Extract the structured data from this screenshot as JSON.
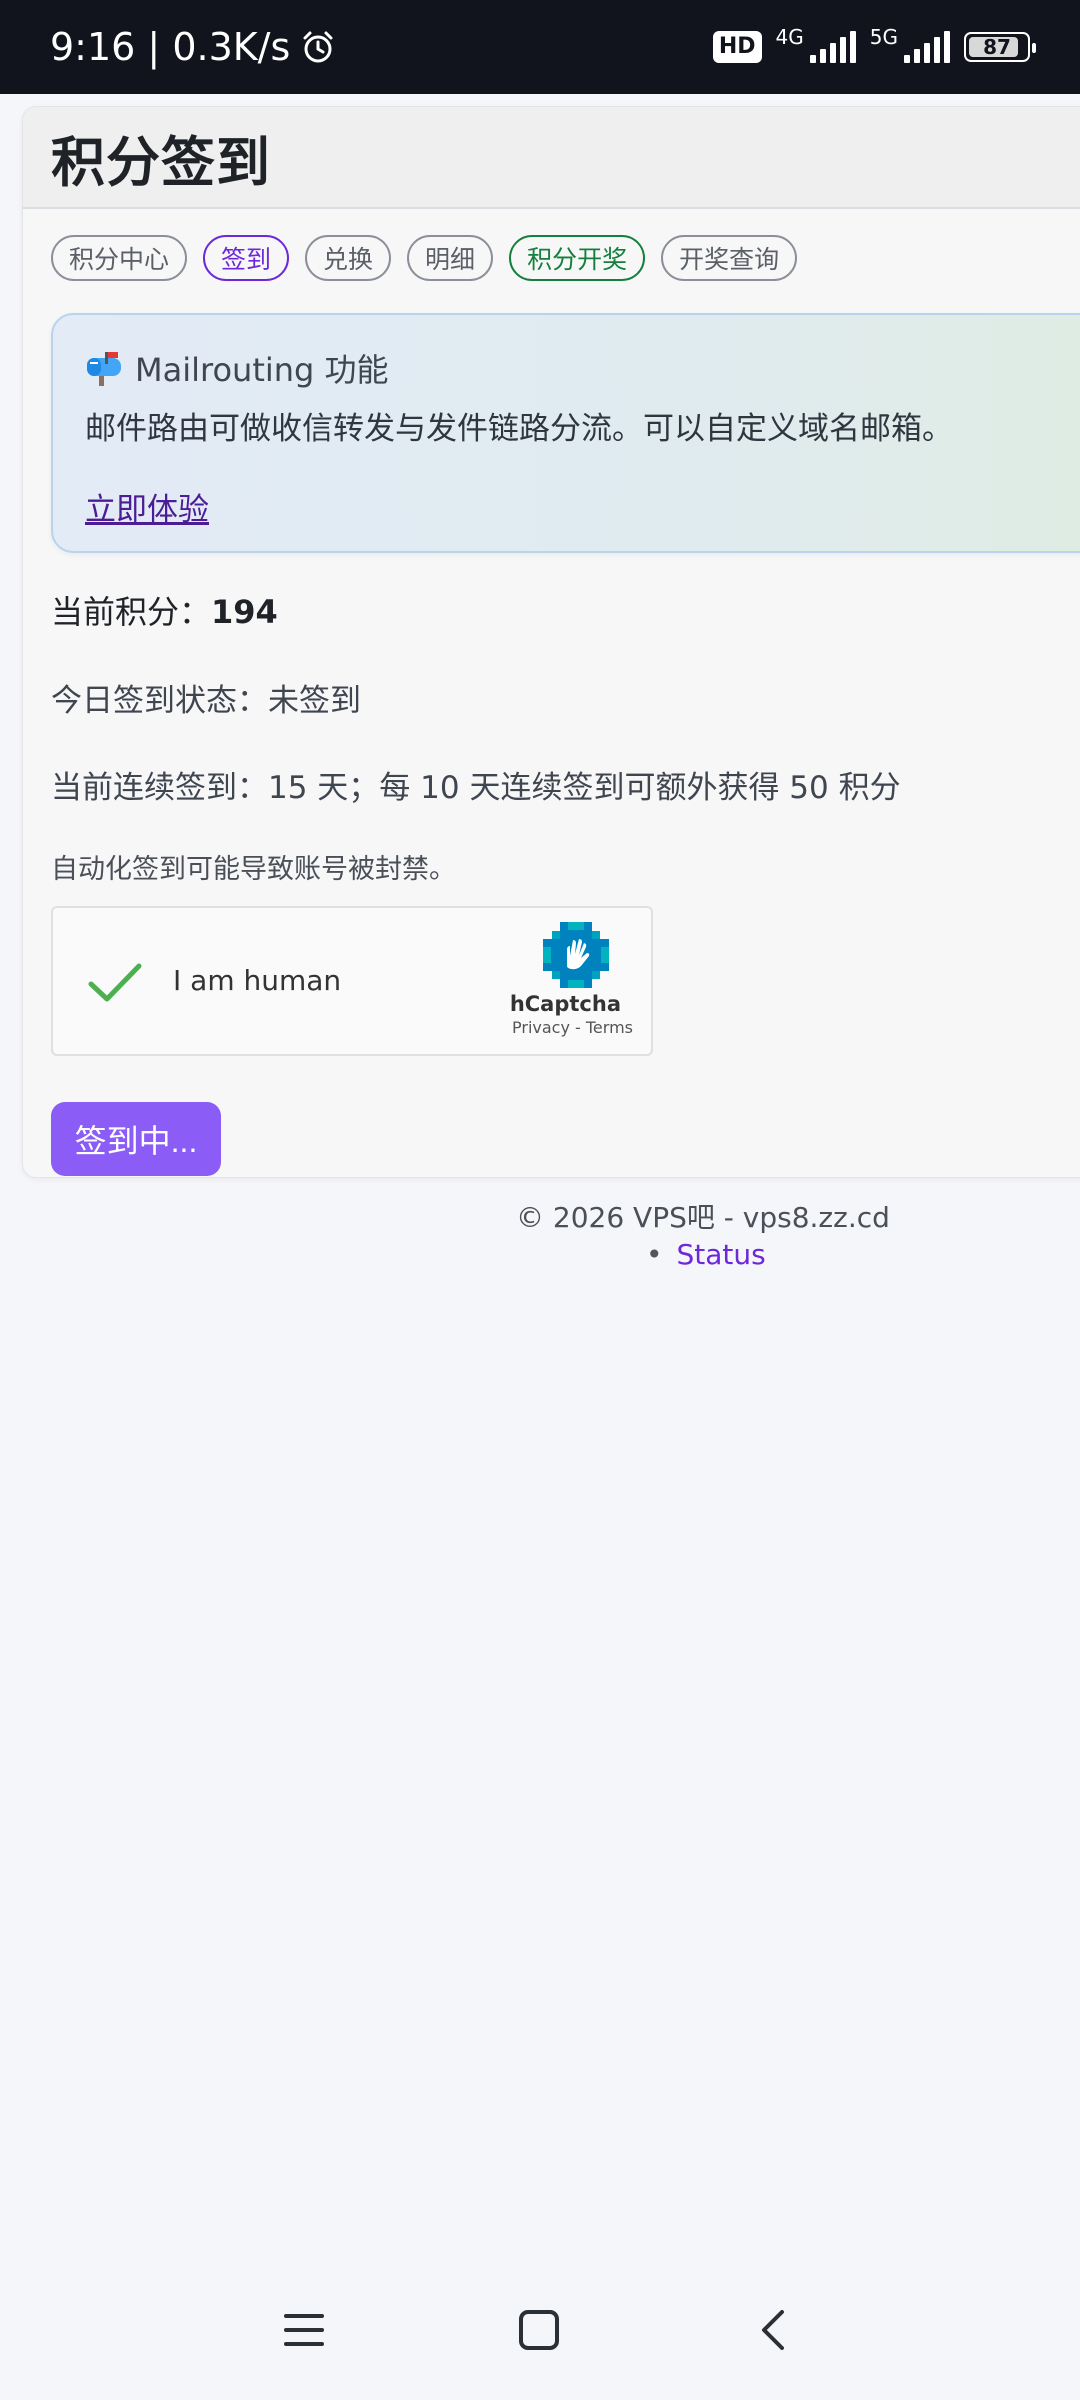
{
  "status_bar": {
    "time": "9:16",
    "speed": "0.3K/s",
    "hd": "HD",
    "net1": "4G",
    "net2": "5G",
    "battery": "87",
    "battery_level": 0.87
  },
  "card": {
    "title": "积分签到"
  },
  "tabs": [
    {
      "label": "积分中心"
    },
    {
      "label": "签到"
    },
    {
      "label": "兑换"
    },
    {
      "label": "明细"
    },
    {
      "label": "积分开奖"
    },
    {
      "label": "开奖查询"
    }
  ],
  "promo": {
    "icon": "mailbox-icon",
    "title": "Mailrouting 功能",
    "description": "邮件路由可做收信转发与发件链路分流。可以自定义域名邮箱。",
    "link": "立即体验"
  },
  "points": {
    "label": "当前积分：",
    "value": "194"
  },
  "status_line": "今日签到状态：未签到",
  "streak_line": "当前连续签到：15 天；每 10 天连续签到可额外获得 50 积分",
  "warning": "自动化签到可能导致账号被封禁。",
  "captcha": {
    "label": "I am human",
    "brand": "hCaptcha",
    "terms": "Privacy - Terms"
  },
  "signin_button": "签到中...",
  "footer": {
    "copyright": "© 2026 VPS吧 - vps8.zz.cd",
    "status_link": "Status"
  },
  "colors": {
    "accent": "#8b5cf6",
    "link": "#6d28d9",
    "green": "#15803d"
  }
}
